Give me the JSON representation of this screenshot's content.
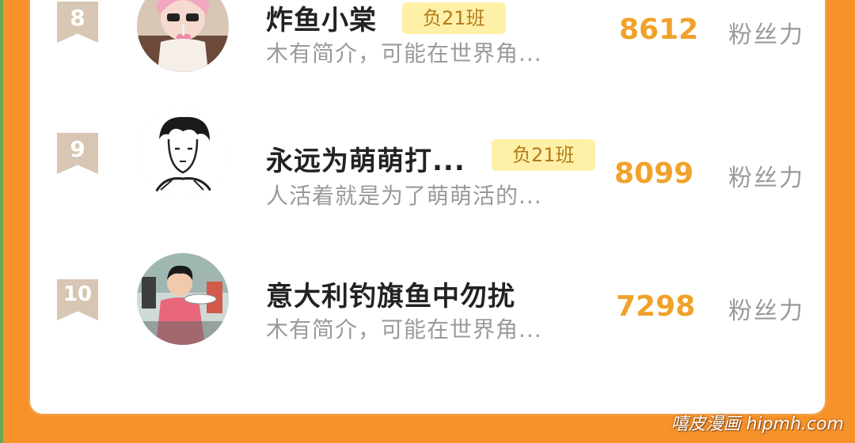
{
  "ranking": [
    {
      "rank": "8",
      "name": "炸鱼小棠",
      "tag": "负21班",
      "intro": "木有简介，可能在世界角...",
      "fans": "8612",
      "fans_unit": "粉丝力",
      "avatar_icon": "anime-girl-drinking-avatar"
    },
    {
      "rank": "9",
      "name": "永远为萌萌打...",
      "tag": "负21班",
      "intro": "人活着就是为了萌萌活的...",
      "fans": "8099",
      "fans_unit": "粉丝力",
      "avatar_icon": "sketch-man-avatar"
    },
    {
      "rank": "10",
      "name": "意大利钓旗鱼中勿扰",
      "tag": "",
      "intro": "木有简介，可能在世界角...",
      "fans": "7298",
      "fans_unit": "粉丝力",
      "avatar_icon": "boy-with-plate-avatar"
    }
  ],
  "watermark": "嘻皮漫画 hipmh.com",
  "colors": {
    "background": "#f7922a",
    "fans_value": "#f0a22a",
    "tag_bg": "#fff0a8",
    "badge": "#d7c6b3"
  }
}
